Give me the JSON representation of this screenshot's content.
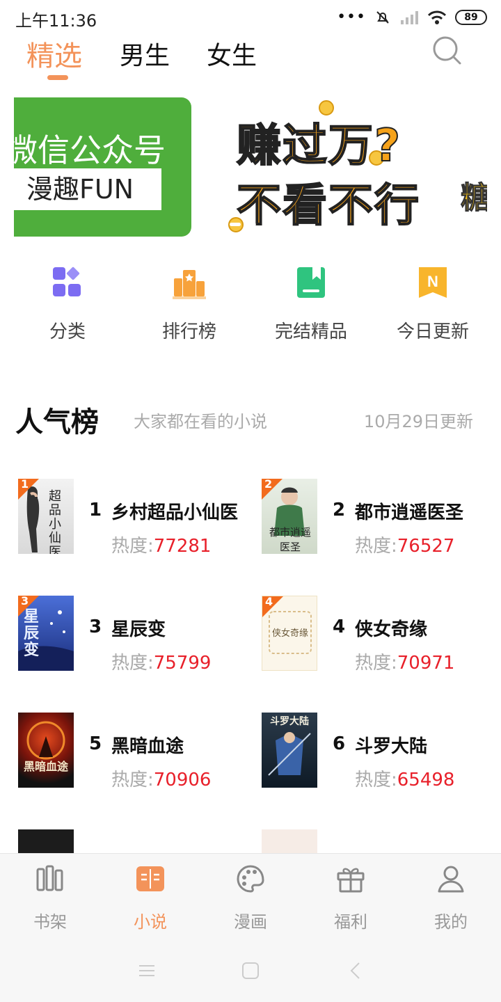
{
  "status_bar": {
    "time": "上午11:36",
    "battery": "89"
  },
  "top_tabs": [
    {
      "label": "精选",
      "active": true
    },
    {
      "label": "男生"
    },
    {
      "label": "女生"
    }
  ],
  "banner": {
    "left_line1": "微信公众号",
    "left_line2": "漫趣FUN",
    "right_line1": "赚过万?",
    "right_line2": "不看不行",
    "right_tag": "糖"
  },
  "shortcuts": [
    {
      "label": "分类",
      "icon": "category-icon",
      "color": "#7c6cf2"
    },
    {
      "label": "排行榜",
      "icon": "podium-icon",
      "color": "#f7a23b"
    },
    {
      "label": "完结精品",
      "icon": "bookmark-book-icon",
      "color": "#2fc47f"
    },
    {
      "label": "今日更新",
      "icon": "new-badge-icon",
      "color": "#f8b52c"
    }
  ],
  "section": {
    "title": "人气榜",
    "subtitle": "大家都在看的小说",
    "updated": "10月29日更新"
  },
  "heat_label": "热度:",
  "books": [
    {
      "rank": "1",
      "title": "乡村超品小仙医",
      "heat": "77281",
      "cover_text": "超品小仙医"
    },
    {
      "rank": "2",
      "title": "都市逍遥医圣",
      "heat": "76527",
      "cover_text": "都市逍遥医圣"
    },
    {
      "rank": "3",
      "title": "星辰变",
      "heat": "75799",
      "cover_text": "星辰变"
    },
    {
      "rank": "4",
      "title": "侠女奇缘",
      "heat": "70971",
      "cover_text": "侠女奇缘"
    },
    {
      "rank": "5",
      "title": "黑暗血途",
      "heat": "70906",
      "cover_text": "黑暗血途"
    },
    {
      "rank": "6",
      "title": "斗罗大陆",
      "heat": "65498",
      "cover_text": "斗罗大陆"
    }
  ],
  "bottom_nav": [
    {
      "label": "书架",
      "icon": "bookshelf-icon"
    },
    {
      "label": "小说",
      "icon": "open-book-icon",
      "active": true
    },
    {
      "label": "漫画",
      "icon": "palette-icon"
    },
    {
      "label": "福利",
      "icon": "gift-icon"
    },
    {
      "label": "我的",
      "icon": "user-icon"
    }
  ],
  "colors": {
    "accent": "#f3935a",
    "heat": "#e8202a",
    "banner_green": "#4fae3c"
  }
}
